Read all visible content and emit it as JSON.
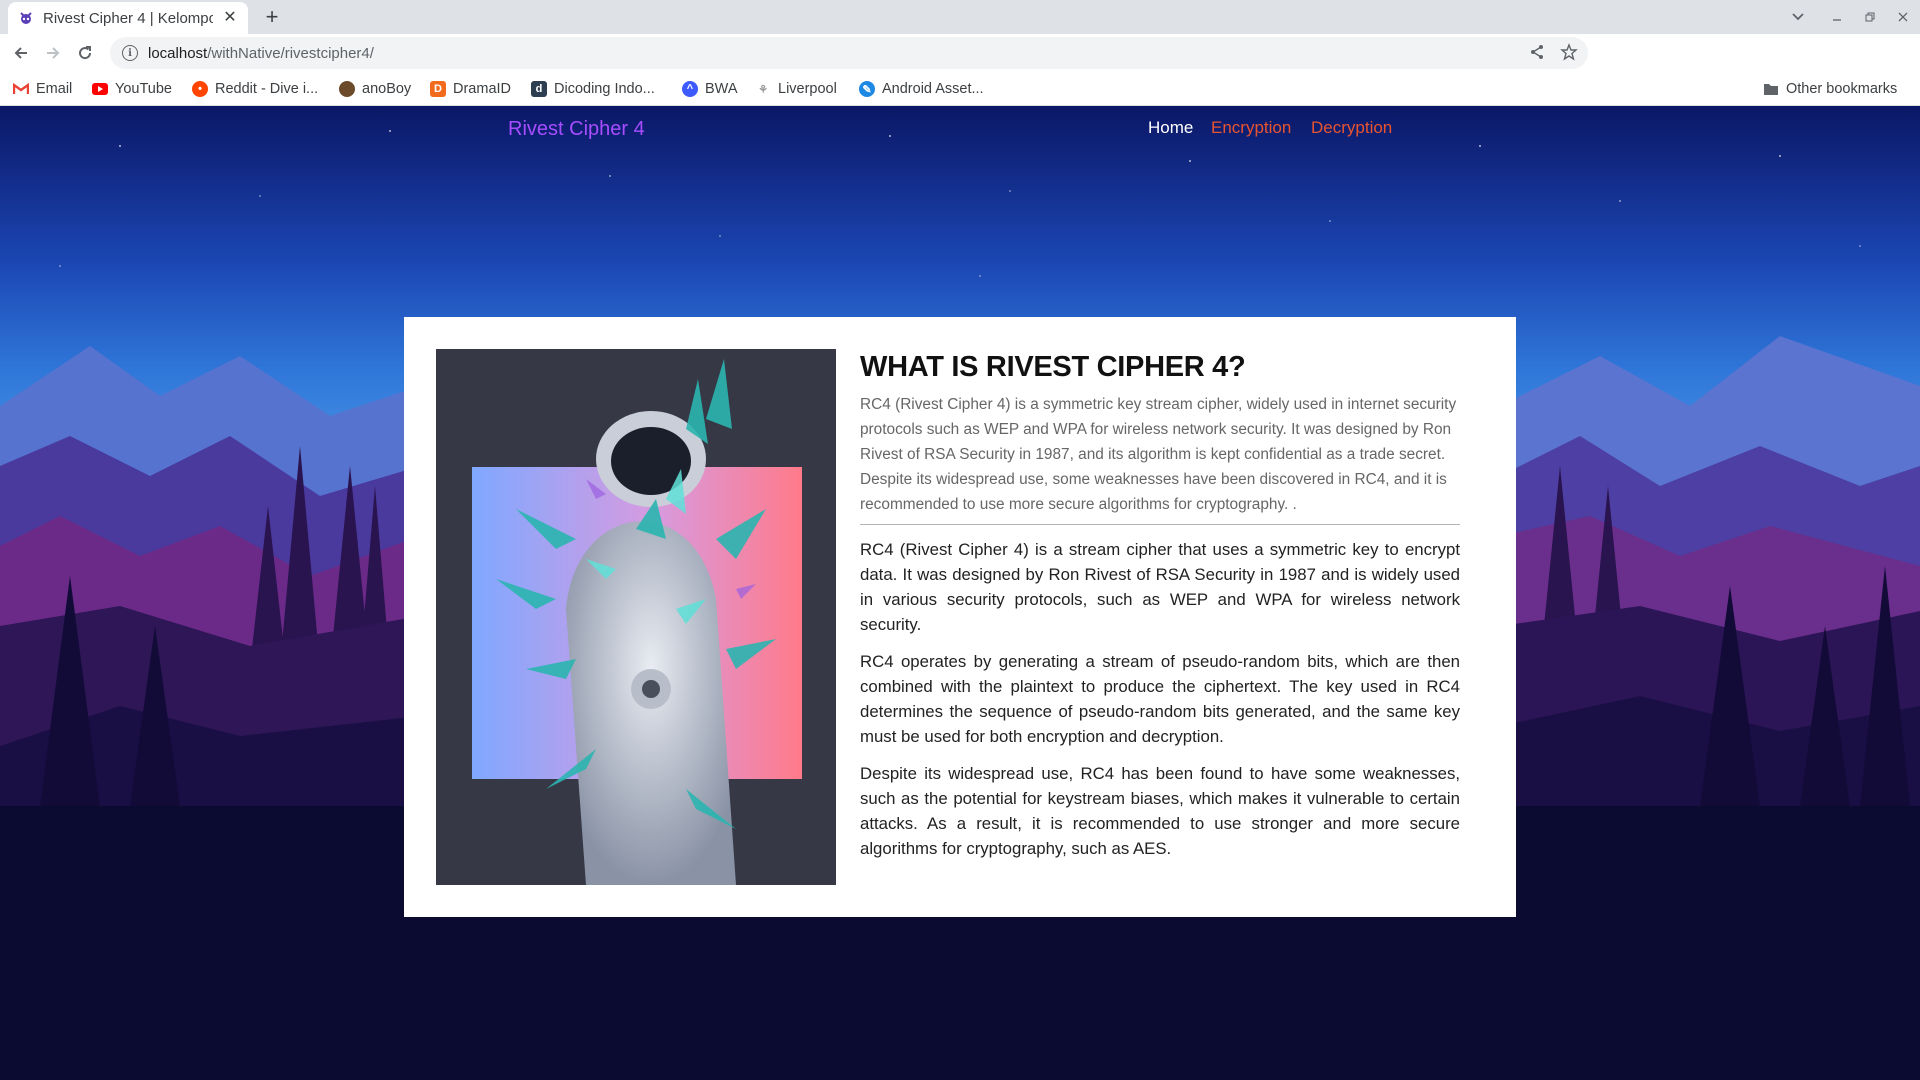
{
  "browser": {
    "tab_title": "Rivest Cipher 4 | Kelompo",
    "new_tab": "+",
    "url_host": "localhost",
    "url_path": "/withNative/rivestcipher4/",
    "bookmarks": [
      {
        "label": "Email",
        "icon": "gmail-icon",
        "color": "#ea4335"
      },
      {
        "label": "YouTube",
        "icon": "youtube-icon",
        "color": "#ff0000"
      },
      {
        "label": "Reddit - Dive i...",
        "icon": "reddit-icon",
        "color": "#ff4500"
      },
      {
        "label": "anoBoy",
        "icon": "anoboy-icon",
        "color": "#6b4b2a"
      },
      {
        "label": "DramaID",
        "icon": "dramaid-icon",
        "color": "#f26b1d"
      },
      {
        "label": "Dicoding Indo...",
        "icon": "dicoding-icon",
        "color": "#2d3e50"
      },
      {
        "label": "BWA",
        "icon": "bwa-icon",
        "color": "#3d5afe"
      },
      {
        "label": "Liverpool",
        "icon": "liverpool-icon",
        "color": "#999999"
      },
      {
        "label": "Android Asset...",
        "icon": "android-asset-icon",
        "color": "#1e88e5"
      }
    ],
    "other_bookmarks": "Other bookmarks"
  },
  "site": {
    "brand": "Rivest Cipher 4",
    "nav": [
      {
        "label": "Home",
        "color": "#ffffff"
      },
      {
        "label": "Encryption",
        "color": "#e8542f"
      },
      {
        "label": "Decryption",
        "color": "#e8542f"
      }
    ]
  },
  "card": {
    "heading": "WHAT IS RIVEST CIPHER 4?",
    "intro": "RC4 (Rivest Cipher 4) is a symmetric key stream cipher, widely used in internet security protocols such as WEP and WPA for wireless network security. It was designed by Ron Rivest of RSA Security in 1987, and its algorithm is kept confidential as a trade secret. Despite its widespread use, some weaknesses have been discovered in RC4, and it is recommended to use more secure algorithms for cryptography. .",
    "paragraphs": [
      "RC4 (Rivest Cipher 4) is a stream cipher that uses a symmetric key to encrypt data. It was designed by Ron Rivest of RSA Security in 1987 and is widely used in various security protocols, such as WEP and WPA for wireless network security.",
      "RC4 operates by generating a stream of pseudo-random bits, which are then combined with the plaintext to produce the ciphertext. The key used in RC4 determines the sequence of pseudo-random bits generated, and the same key must be used for both encryption and decryption.",
      "Despite its widespread use, RC4 has been found to have some weaknesses, such as the potential for keystream biases, which makes it vulnerable to certain attacks. As a result, it is recommended to use stronger and more secure algorithms for cryptography, such as AES."
    ]
  }
}
